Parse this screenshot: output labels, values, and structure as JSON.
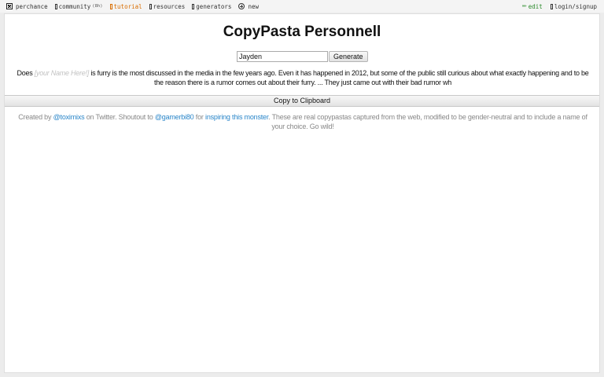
{
  "nav": {
    "left": [
      {
        "label": "perchance",
        "icon": "dice-logo-icon"
      },
      {
        "label": "community",
        "badge": "(8h)",
        "icon": "box-icon"
      },
      {
        "label": "tutorial",
        "icon": "box-icon"
      },
      {
        "label": "resources",
        "icon": "box-icon"
      },
      {
        "label": "generators",
        "icon": "box-icon"
      },
      {
        "label": "new",
        "icon": "plus-circle-icon"
      }
    ],
    "right": [
      {
        "label": "edit",
        "icon": "pencil-icon"
      },
      {
        "label": "login/signup",
        "icon": "box-icon"
      }
    ]
  },
  "colors": {
    "accent_tutorial": "#d96d00",
    "accent_edit": "#2a8a2a",
    "link": "#2a86c9"
  },
  "page": {
    "title": "CopyPasta Personnell",
    "name_value": "Jayden",
    "generate_label": "Generate",
    "pasta_prefix": "Does ",
    "pasta_placeholder": "[your Name Here!]",
    "pasta_rest": " is furry is the most discussed in the media in the few years ago. Even it has happened in 2012, but some of the public still curious about what exactly happening and to be the reason there is a rumor comes out about their furry. ... They just came out with their bad rumor wh",
    "copy_label": "Copy to Clipboard"
  },
  "credits": {
    "t1": "Created by ",
    "link1": "@toximixs",
    "t2": " on Twitter. Shoutout to ",
    "link2": "@gamerbi80",
    "t3": " for ",
    "link3": "inspiring this monster",
    "t4": ". These are real copypastas captured from the web, modified to be gender-neutral and to include a name of your choice. Go wild!"
  }
}
